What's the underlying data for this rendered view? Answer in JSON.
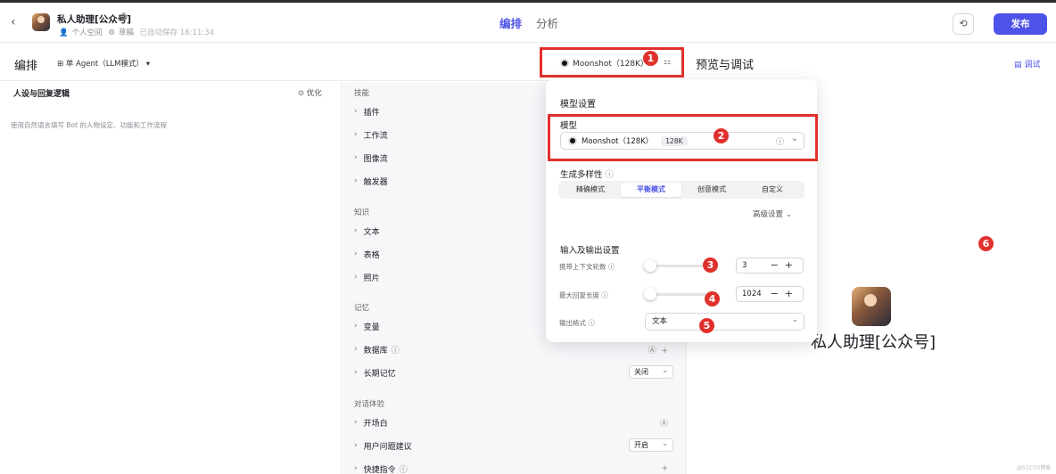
{
  "header": {
    "bot_name": "私人助理[公众号]",
    "space": "个人空间",
    "status": "草稿",
    "autosave": "已自动保存 16:11:34",
    "tabs": [
      "编排",
      "分析"
    ],
    "publish_label": "发布"
  },
  "subbar": {
    "title": "编排",
    "agent_mode": "单 Agent（LLM模式）",
    "model": "Moonshot（128K）"
  },
  "left": {
    "title": "人设与回复逻辑",
    "optimize": "优化",
    "placeholder": "使用自然语言填写 Bot 的人物设定、功能和工作流程"
  },
  "middle": {
    "group_skills": "技能",
    "plugin": "插件",
    "workflow": "工作流",
    "imageflow": "图像流",
    "trigger": "触发器",
    "group_knowledge": "知识",
    "text": "文本",
    "table": "表格",
    "photo": "照片",
    "group_memory": "记忆",
    "variable": "变量",
    "database": "数据库",
    "longterm": "长期记忆",
    "longterm_value": "关闭",
    "group_dialog": "对话体验",
    "opening": "开场白",
    "suggestion": "用户问题建议",
    "suggestion_value": "开启",
    "shortcut": "快捷指令"
  },
  "popup": {
    "title": "模型设置",
    "model_label": "模型",
    "model_value": "Moonshot（128K）",
    "context_tag": "128K",
    "diversity_label": "生成多样性",
    "modes": [
      "精确模式",
      "平衡模式",
      "创意模式",
      "自定义"
    ],
    "active_mode": 1,
    "advanced": "高级设置",
    "io_label": "输入及输出设置",
    "context_rounds_label": "携带上下文轮数",
    "context_rounds_value": "3",
    "max_reply_label": "最大回复长度",
    "max_reply_value": "1024",
    "output_format_label": "输出格式",
    "output_format_value": "文本"
  },
  "preview": {
    "title": "预览与调试",
    "debug": "调试",
    "bot_name": "私人助理[公众号]"
  },
  "annotations": [
    "1",
    "2",
    "3",
    "4",
    "5",
    "6"
  ],
  "watermark": "@51CTO博客",
  "colors": {
    "accent": "#4d53e8",
    "annotation_red": "#e0302c"
  }
}
